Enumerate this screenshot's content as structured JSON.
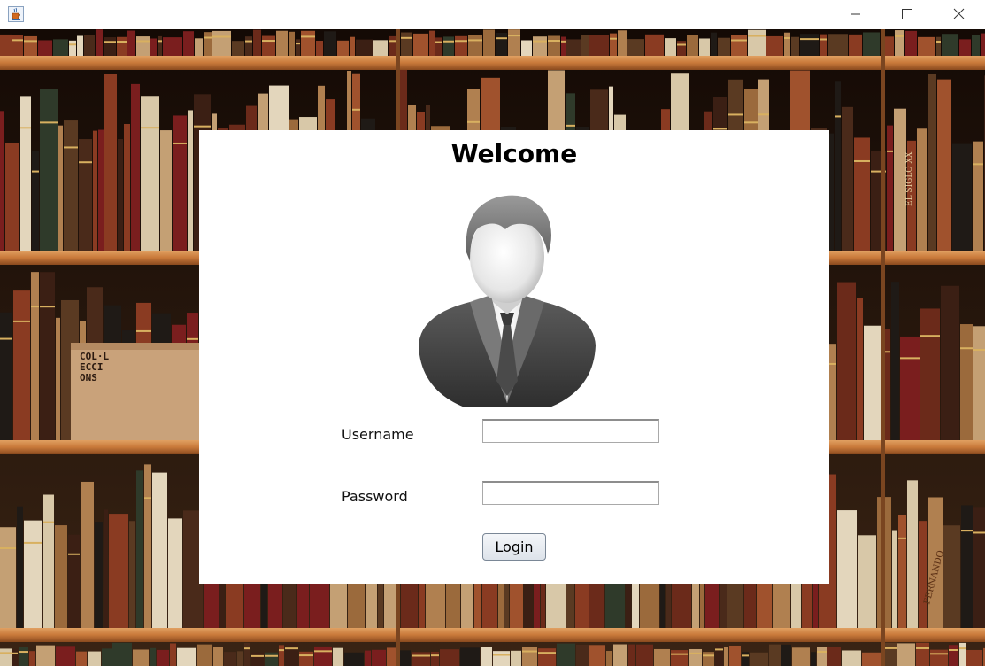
{
  "window": {
    "icons": {
      "app": "java-cup-icon",
      "minimize": "minimize-icon",
      "maximize": "maximize-icon",
      "close": "close-icon"
    }
  },
  "login": {
    "heading": "Welcome",
    "avatar_icon": "user-avatar-icon",
    "username_label": "Username",
    "username_value": "",
    "password_label": "Password",
    "password_value": "",
    "login_button": "Login"
  },
  "background": {
    "book_spine_text": [
      "COL·L",
      "ECCI",
      "ONS",
      "EL SIGLO XX",
      "FERNANDO"
    ]
  },
  "colors": {
    "panel": "#ffffff",
    "shelf": "#c8793a",
    "button_border": "#7a8796"
  }
}
